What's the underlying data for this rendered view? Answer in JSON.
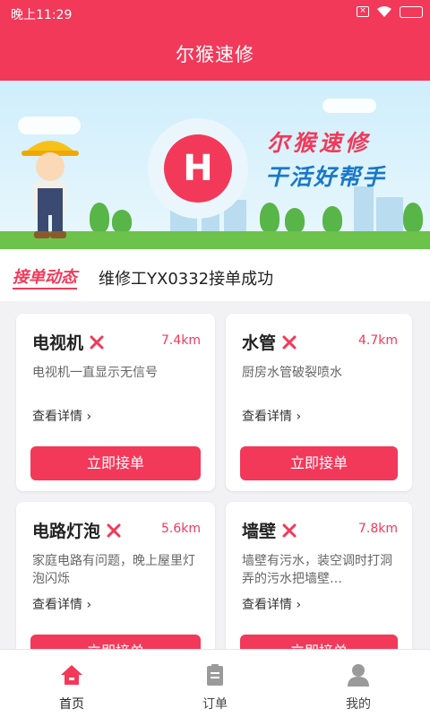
{
  "status": {
    "time": "晚上11:29",
    "sim_icon": "sim-error-icon",
    "wifi_icon": "wifi-icon",
    "battery_icon": "battery-charging-icon",
    "battery_color": "#9be36b"
  },
  "header": {
    "title": "尔猴速修",
    "color": "#f2395a"
  },
  "banner": {
    "line1": "尔猴速修",
    "line2": "干活好帮手",
    "logo_icon": "logo-icon",
    "logo_text": "H"
  },
  "ticker": {
    "tag": "接单动态",
    "message": "维修工YX0332接单成功"
  },
  "cards": [
    {
      "title": "电视机",
      "distance": "7.4km",
      "desc": "电视机一直显示无信号",
      "more": "查看详情 ›",
      "button": "立即接单"
    },
    {
      "title": "水管",
      "distance": "4.7km",
      "desc": "厨房水管破裂喷水",
      "more": "查看详情 ›",
      "button": "立即接单"
    },
    {
      "title": "电路灯泡",
      "distance": "5.6km",
      "desc": "家庭电路有问题，晚上屋里灯泡闪烁",
      "more": "查看详情 ›",
      "button": "立即接单"
    },
    {
      "title": "墙壁",
      "distance": "7.8km",
      "desc": "墙壁有污水，装空调时打洞弄的污水把墙壁…",
      "more": "查看详情 ›",
      "button": "立即接单"
    }
  ],
  "tabs": [
    {
      "label": "首页",
      "icon": "home-icon",
      "active": true
    },
    {
      "label": "订单",
      "icon": "clipboard-icon",
      "active": false
    },
    {
      "label": "我的",
      "icon": "user-icon",
      "active": false
    }
  ]
}
